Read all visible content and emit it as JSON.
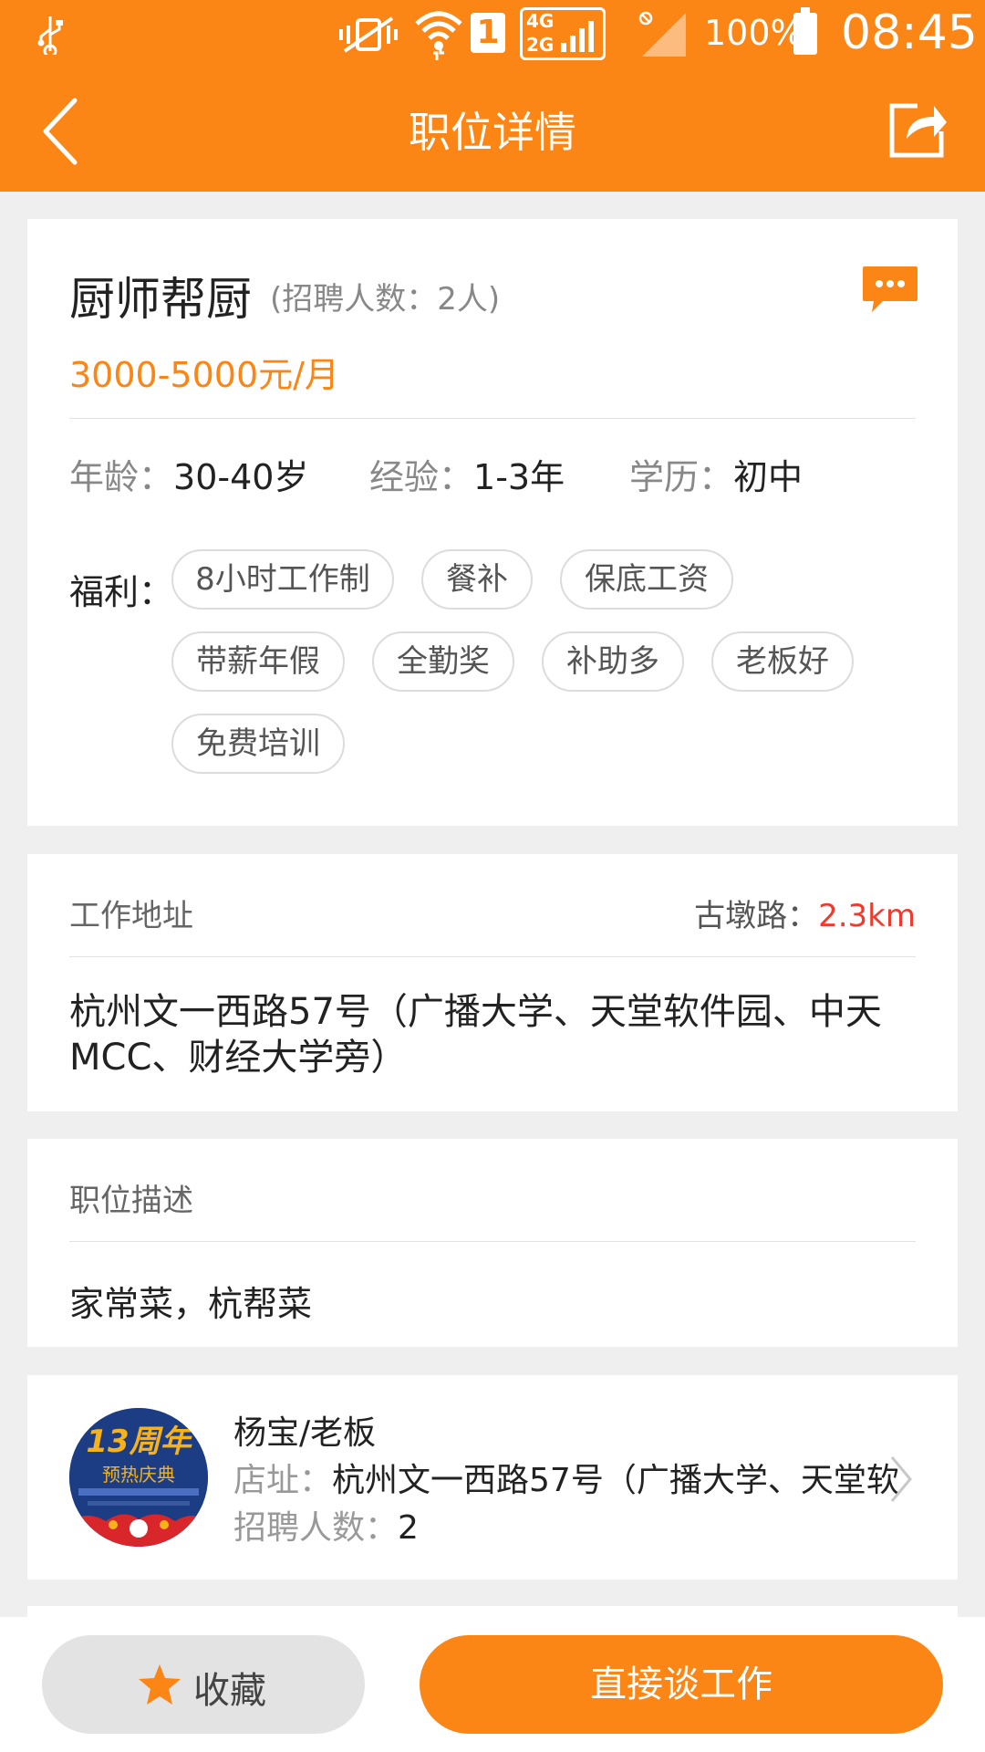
{
  "status_bar": {
    "network_top": "4G",
    "network_bottom": "2G",
    "sim_slot": "1",
    "battery": "100%",
    "time": "08:45"
  },
  "header": {
    "title": "职位详情",
    "back_icon": "chevron-left-icon",
    "share_icon": "share-icon"
  },
  "job": {
    "title": "厨师帮厨",
    "headcount": "(招聘人数：2人)",
    "salary": "3000-5000元/月",
    "requirements": [
      {
        "label": "年龄：",
        "value": "30-40岁"
      },
      {
        "label": "经验：",
        "value": "1-3年"
      },
      {
        "label": "学历：",
        "value": "初中"
      }
    ],
    "benefits_label": "福利：",
    "benefits": [
      "8小时工作制",
      "餐补",
      "保底工资",
      "带薪年假",
      "全勤奖",
      "补助多",
      "老板好",
      "免费培训"
    ]
  },
  "address": {
    "label": "工作地址",
    "distance_label": "古墩路：",
    "distance_value": "2.3km",
    "text": "杭州文一西路57号（广播大学、天堂软件园、中天MCC、财经大学旁）"
  },
  "description": {
    "label": "职位描述",
    "text": "家常菜，杭帮菜"
  },
  "employer": {
    "name": "杨宝/老板",
    "address_label": "店址：",
    "address_value": "杭州文一西路57号（广播大学、天堂软",
    "count_label": "招聘人数：",
    "count_value": "2",
    "avatar_text_big": "13周年",
    "avatar_text_sub": "预热庆典"
  },
  "actions": {
    "favorite_label": "收藏",
    "talk_label": "直接谈工作"
  },
  "colors": {
    "accent": "#fb8616",
    "distance": "#ee3b2e"
  }
}
